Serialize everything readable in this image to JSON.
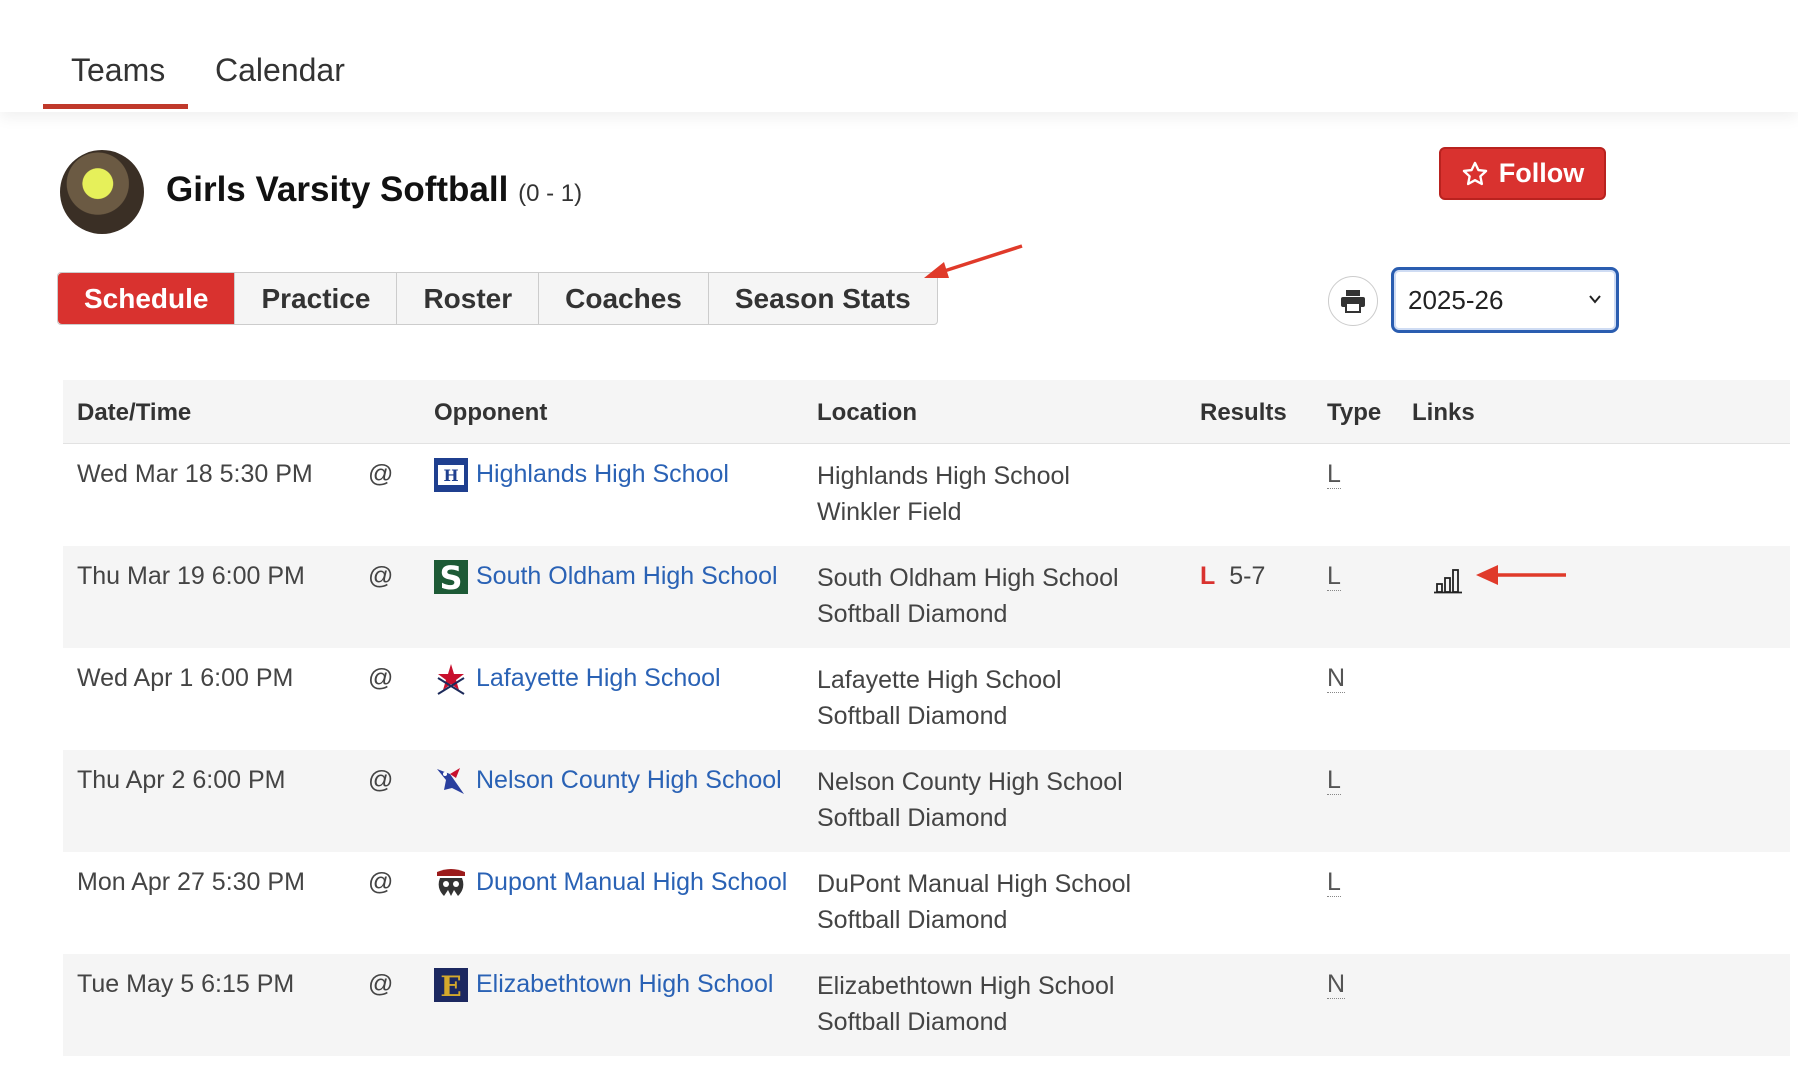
{
  "topnav": {
    "tabs": [
      "Teams",
      "Calendar"
    ],
    "active": "Teams"
  },
  "team": {
    "name": "Girls Varsity Softball",
    "record": "(0 - 1)",
    "follow_label": "Follow"
  },
  "tabs": [
    "Schedule",
    "Practice",
    "Roster",
    "Coaches",
    "Season Stats"
  ],
  "active_tab": "Schedule",
  "season": {
    "selected": "2025-26"
  },
  "colors": {
    "accent": "#d9322f",
    "link": "#2a62b5",
    "select_border": "#2a5db0"
  },
  "table": {
    "headers": {
      "date": "Date/Time",
      "opponent": "Opponent",
      "location": "Location",
      "results": "Results",
      "type": "Type",
      "links": "Links"
    },
    "rows": [
      {
        "date": "Wed Mar 18 5:30 PM",
        "at": "@",
        "opponent": "Highlands High School",
        "logo": "highlands-logo",
        "loc1": "Highlands High School",
        "loc2": "Winkler Field",
        "result_wl": "",
        "result_score": "",
        "type": "L",
        "link": ""
      },
      {
        "date": "Thu Mar 19 6:00 PM",
        "at": "@",
        "opponent": "South Oldham High School",
        "logo": "south-oldham-logo",
        "loc1": "South Oldham High School",
        "loc2": "Softball Diamond",
        "result_wl": "L",
        "result_score": "5-7",
        "type": "L",
        "link": "stats-icon"
      },
      {
        "date": "Wed Apr 1 6:00 PM",
        "at": "@",
        "opponent": "Lafayette High School",
        "logo": "lafayette-logo",
        "loc1": "Lafayette High School",
        "loc2": "Softball Diamond",
        "result_wl": "",
        "result_score": "",
        "type": "N",
        "link": ""
      },
      {
        "date": "Thu Apr 2 6:00 PM",
        "at": "@",
        "opponent": "Nelson County High School",
        "logo": "nelson-county-logo",
        "loc1": "Nelson County High School",
        "loc2": "Softball Diamond",
        "result_wl": "",
        "result_score": "",
        "type": "L",
        "link": ""
      },
      {
        "date": "Mon Apr 27 5:30 PM",
        "at": "@",
        "opponent": "Dupont Manual High School",
        "logo": "dupont-manual-logo",
        "loc1": "DuPont Manual High School",
        "loc2": "Softball Diamond",
        "result_wl": "",
        "result_score": "",
        "type": "L",
        "link": ""
      },
      {
        "date": "Tue May 5 6:15 PM",
        "at": "@",
        "opponent": "Elizabethtown High School",
        "logo": "elizabethtown-logo",
        "loc1": "Elizabethtown High School",
        "loc2": "Softball Diamond",
        "result_wl": "",
        "result_score": "",
        "type": "N",
        "link": ""
      }
    ]
  }
}
